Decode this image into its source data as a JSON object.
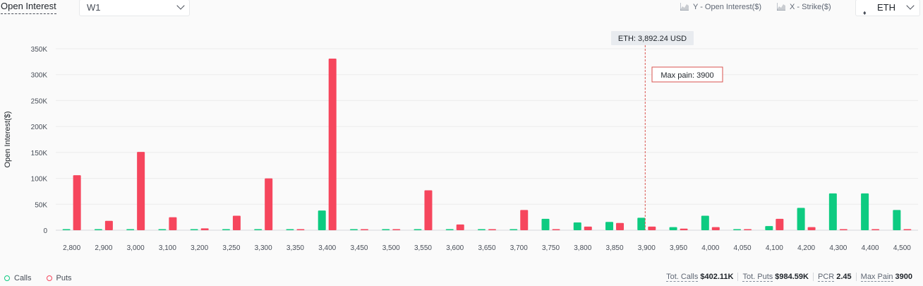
{
  "header": {
    "title": "Open Interest",
    "period": "W1",
    "y_axis_option": "Y - Open Interest($)",
    "x_axis_option": "X - Strike($)",
    "coin": "ETH"
  },
  "legend": {
    "calls": "Calls",
    "puts": "Puts"
  },
  "stats": [
    {
      "label": "Tot. Calls",
      "value": "$402.11K"
    },
    {
      "label": "Tot. Puts",
      "value": "$984.59K"
    },
    {
      "label": "PCR",
      "value": "2.45"
    },
    {
      "label": "Max Pain",
      "value": "3900"
    }
  ],
  "colors": {
    "calls": "#0ecb81",
    "puts": "#f6465d",
    "maxpain": "#d9534f",
    "grid": "#ececec"
  },
  "chart_data": {
    "type": "bar",
    "ylabel": "Open Interest($)",
    "ylim": [
      0,
      350000
    ],
    "yticks": [
      "0",
      "50K",
      "100K",
      "150K",
      "200K",
      "250K",
      "300K",
      "350K"
    ],
    "categories": [
      "2,800",
      "2,900",
      "3,000",
      "3,100",
      "3,200",
      "3,250",
      "3,300",
      "3,350",
      "3,400",
      "3,450",
      "3,500",
      "3,550",
      "3,600",
      "3,650",
      "3,700",
      "3,750",
      "3,800",
      "3,850",
      "3,900",
      "3,950",
      "4,000",
      "4,050",
      "4,100",
      "4,200",
      "4,300",
      "4,400",
      "4,500"
    ],
    "series": [
      {
        "name": "Calls",
        "values": [
          2000,
          2000,
          2000,
          2000,
          2000,
          2000,
          2000,
          2000,
          38000,
          2000,
          2000,
          2000,
          2000,
          2000,
          2000,
          22000,
          15000,
          16000,
          24000,
          6000,
          28000,
          2000,
          8000,
          43000,
          71000,
          71000,
          39000
        ]
      },
      {
        "name": "Puts",
        "values": [
          106000,
          18000,
          151000,
          25000,
          3500,
          28000,
          100000,
          2000,
          331000,
          2000,
          2000,
          77000,
          11000,
          2000,
          39000,
          2000,
          7000,
          14000,
          7000,
          3000,
          6000,
          2000,
          22000,
          6000,
          2000,
          2000,
          2000
        ]
      }
    ],
    "spot_label": "ETH: 3,892.24 USD",
    "max_pain_label": "Max pain: 3900",
    "max_pain_category": "3,900"
  }
}
